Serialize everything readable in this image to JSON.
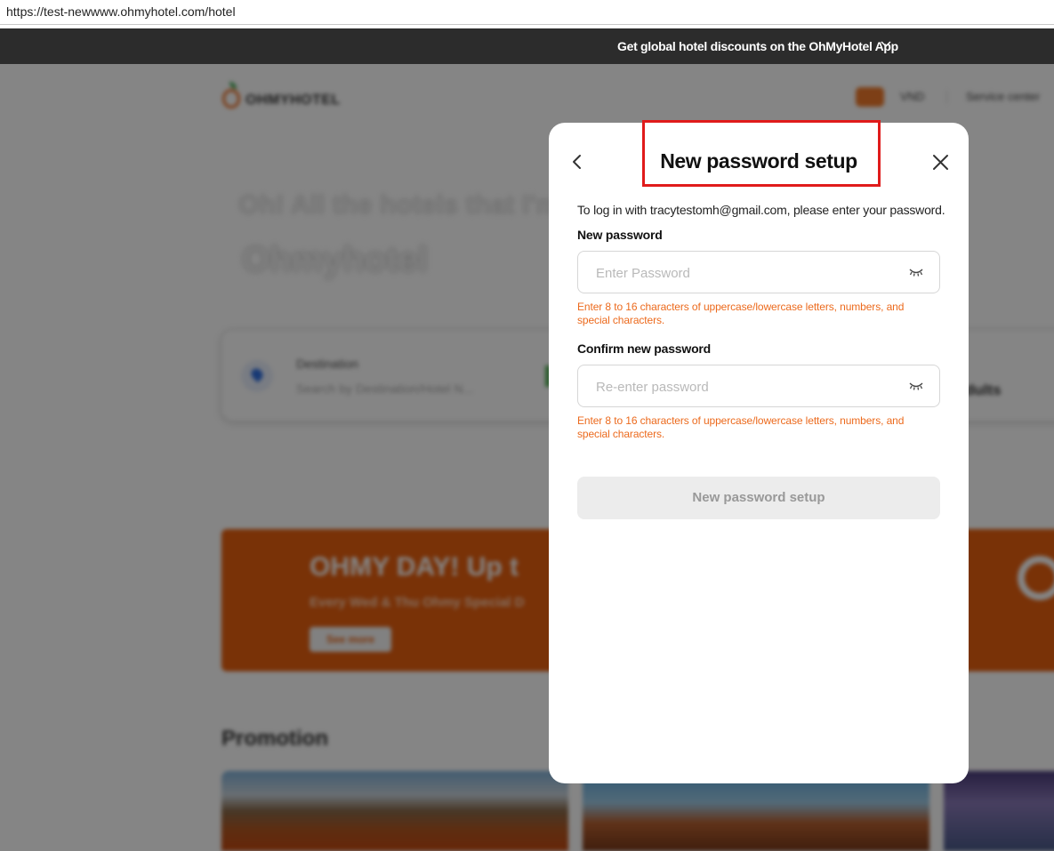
{
  "browser": {
    "url": "https://test-newwww.ohmyhotel.com/hotel"
  },
  "app_banner": {
    "text": "Get global hotel discounts on the OhMyHotel App"
  },
  "background": {
    "logo_text": "OHMYHOTEL",
    "currency": "VND",
    "service_center": "Service center",
    "hero_line1": "Oh! All the hotels that I'm",
    "hero_line2": "Ohmyhotel",
    "destination_label": "Destination",
    "destination_placeholder": "Search by Destination/Hotel N...",
    "guests_value": "dults",
    "promo_title": "OHMY DAY! Up t",
    "promo_sub": "Every Wed & Thu Ohmy Special D",
    "promo_button": "See more",
    "promotion_heading": "Promotion"
  },
  "modal": {
    "title": "New password setup",
    "intro": "To log in with tracytestomh@gmail.com, please enter your password.",
    "new_password": {
      "label": "New password",
      "placeholder": "Enter Password",
      "hint": "Enter 8 to 16 characters of uppercase/lowercase letters, numbers, and special characters."
    },
    "confirm_password": {
      "label": "Confirm new password",
      "placeholder": "Re-enter password",
      "hint": "Enter 8 to 16 characters of uppercase/lowercase letters, numbers, and special characters."
    },
    "submit_label": "New password setup",
    "colors": {
      "hint": "#ec6a1d",
      "highlight_box": "#e01b1b",
      "button_disabled_bg": "#ececec"
    }
  }
}
